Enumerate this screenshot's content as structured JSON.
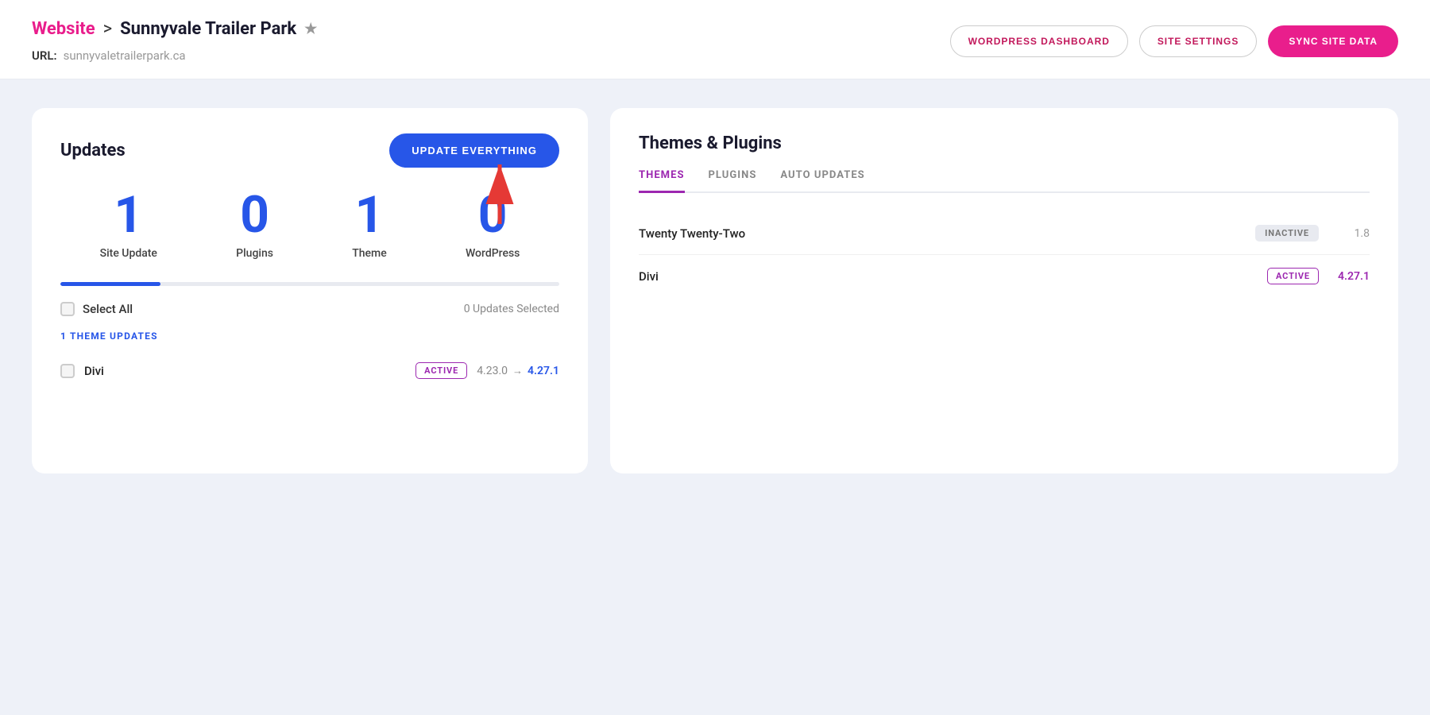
{
  "header": {
    "breadcrumb_link": "Website",
    "breadcrumb_separator": ">",
    "site_name": "Sunnyvale Trailer Park",
    "url_label": "URL:",
    "url_value": "sunnyvaletrailerpark.ca",
    "buttons": {
      "wordpress_dashboard": "WORDPRESS DASHBOARD",
      "site_settings": "SITE SETTINGS",
      "sync_site_data": "SYNC SITE DATA"
    }
  },
  "updates_panel": {
    "title": "Updates",
    "update_button": "UPDATE EVERYTHING",
    "stats": [
      {
        "number": "1",
        "label": "Site Update"
      },
      {
        "number": "0",
        "label": "Plugins"
      },
      {
        "number": "1",
        "label": "Theme"
      },
      {
        "number": "0",
        "label": "WordPress"
      }
    ],
    "select_all_label": "Select All",
    "updates_selected": "0 Updates Selected",
    "section_label": "1 THEME UPDATES",
    "theme_update": {
      "name": "Divi",
      "badge": "ACTIVE",
      "version_from": "4.23.0",
      "arrow": "→",
      "version_to": "4.27.1"
    }
  },
  "themes_panel": {
    "title": "Themes & Plugins",
    "tabs": [
      {
        "label": "THEMES",
        "active": true
      },
      {
        "label": "PLUGINS",
        "active": false
      },
      {
        "label": "AUTO UPDATES",
        "active": false
      }
    ],
    "themes": [
      {
        "name": "Twenty Twenty-Two",
        "badge": "INACTIVE",
        "badge_type": "inactive",
        "version": "1.8"
      },
      {
        "name": "Divi",
        "badge": "ACTIVE",
        "badge_type": "active",
        "version": "4.27.1"
      }
    ]
  },
  "colors": {
    "pink": "#e91e8c",
    "blue": "#2756e8",
    "purple": "#9c27b0",
    "inactive_badge_bg": "#e8eaf0",
    "inactive_badge_text": "#777"
  }
}
